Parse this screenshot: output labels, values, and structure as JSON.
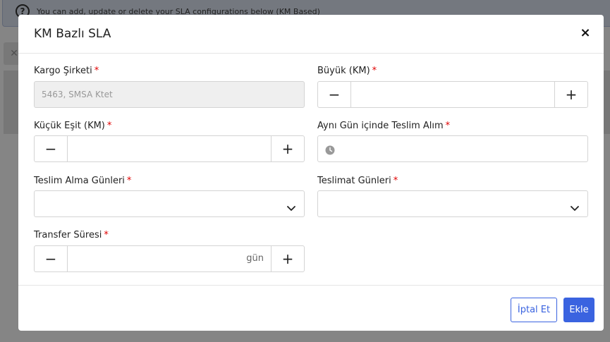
{
  "background": {
    "banner_help": "?",
    "banner_text": "You can add, update or delete your SLA configurations below (KM Based)"
  },
  "modal": {
    "title": "KM Bazlı SLA",
    "close_symbol": "×",
    "required_mark": "*",
    "fields": {
      "kargo_sirketi": {
        "label": "Kargo Şirketi",
        "value": "5463, SMSA Ktet"
      },
      "buyuk_km": {
        "label": "Büyük (KM)",
        "value": ""
      },
      "kucuk_esit_km": {
        "label": "Küçük Eşit (KM)",
        "value": ""
      },
      "ayni_gun": {
        "label": "Aynı Gün içinde Teslim Alım",
        "value": ""
      },
      "teslim_alma_gunleri": {
        "label": "Teslim Alma Günleri",
        "value": ""
      },
      "teslimat_gunleri": {
        "label": "Teslimat Günleri",
        "value": ""
      },
      "transfer_suresi": {
        "label": "Transfer Süresi",
        "value": "",
        "suffix": "gün"
      }
    },
    "stepper": {
      "minus": "−",
      "plus": "+"
    },
    "footer": {
      "cancel_label": "İptal Et",
      "add_label": "Ekle"
    }
  },
  "colors": {
    "accent": "#3a63e0",
    "required": "#e00000"
  }
}
